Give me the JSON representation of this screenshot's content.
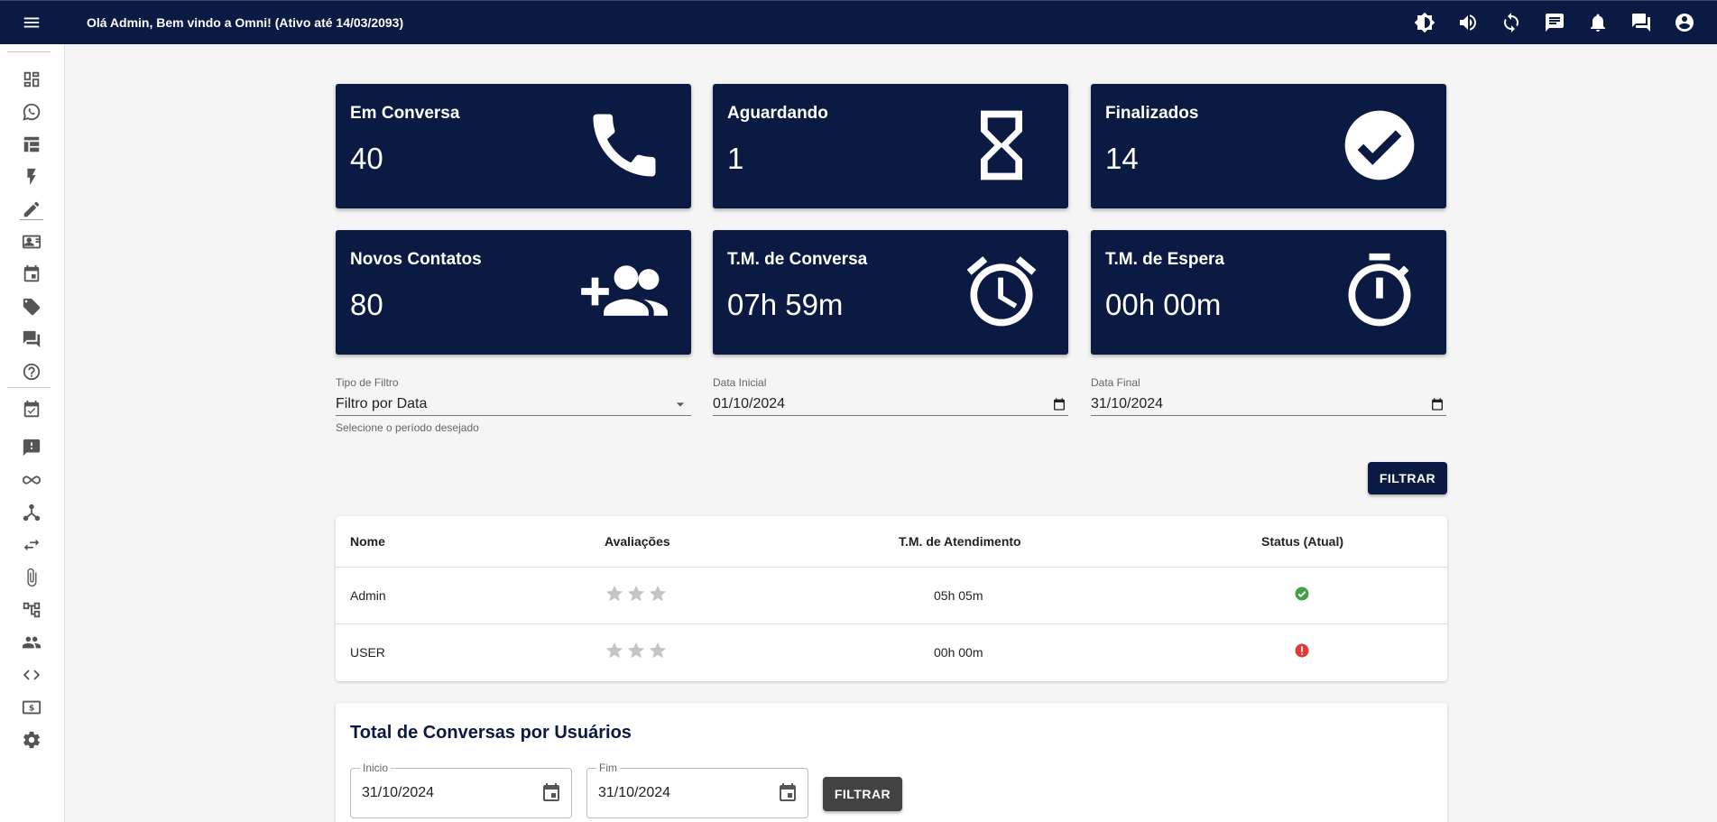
{
  "header": {
    "title": "Olá Admin, Bem vindo a Omni! (Ativo até 14/03/2093)",
    "icons": [
      "brightness-icon",
      "volume-icon",
      "sync-icon",
      "chat-icon",
      "bell-icon",
      "forum-icon",
      "account-icon"
    ]
  },
  "sidebar": {
    "items": [
      "dashboard",
      "whatsapp",
      "table",
      "flash",
      "edit",
      "contacts",
      "calendar",
      "tags",
      "chat",
      "help",
      "tasks",
      "feedback",
      "infinity",
      "hub",
      "transfer",
      "attachment",
      "flow",
      "users",
      "code",
      "billing",
      "settings"
    ]
  },
  "cards": [
    {
      "label": "Em Conversa",
      "value": "40",
      "icon": "phone-icon"
    },
    {
      "label": "Aguardando",
      "value": "1",
      "icon": "hourglass-icon"
    },
    {
      "label": "Finalizados",
      "value": "14",
      "icon": "check-circle-icon"
    },
    {
      "label": "Novos Contatos",
      "value": "80",
      "icon": "add-group-icon"
    },
    {
      "label": "T.M. de Conversa",
      "value": "07h 59m",
      "icon": "alarm-icon"
    },
    {
      "label": "T.M. de Espera",
      "value": "00h 00m",
      "icon": "timer-icon"
    }
  ],
  "filters": {
    "type_label": "Tipo de Filtro",
    "type_value": "Filtro por Data",
    "type_hint": "Selecione o período desejado",
    "start_label": "Data Inicial",
    "start_value": "01/10/2024",
    "end_label": "Data Final",
    "end_value": "31/10/2024",
    "button": "FILTRAR"
  },
  "table": {
    "headers": [
      "Nome",
      "Avaliações",
      "T.M. de Atendimento",
      "Status (Atual)"
    ],
    "rows": [
      {
        "name": "Admin",
        "rating": 0,
        "time": "05h 05m",
        "status": "online",
        "status_color": "#43a047"
      },
      {
        "name": "USER",
        "rating": 0,
        "time": "00h 00m",
        "status": "offline",
        "status_color": "#e53935"
      }
    ]
  },
  "users_chart": {
    "title": "Total de Conversas por Usuários",
    "start_label": "Inicio",
    "start_value": "31/10/2024",
    "end_label": "Fim",
    "end_value": "31/10/2024",
    "button": "FILTRAR"
  },
  "colors": {
    "primary": "#0b1a42",
    "success": "#43a047",
    "error": "#e53935"
  }
}
